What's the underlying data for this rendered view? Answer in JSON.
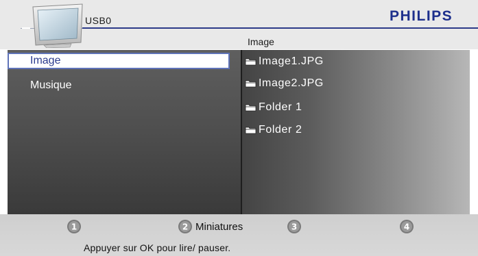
{
  "header": {
    "source_title": "USB0",
    "brand": "PHILIPS",
    "column_title": "Image"
  },
  "menu": {
    "items": [
      {
        "label": "Image",
        "selected": true
      },
      {
        "label": "Musique",
        "selected": false
      }
    ]
  },
  "files": {
    "items": [
      {
        "label": "Image1.JPG",
        "icon": "folder-icon"
      },
      {
        "label": "Image2.JPG",
        "icon": "folder-icon"
      },
      {
        "label": "Folder 1",
        "icon": "folder-icon"
      },
      {
        "label": "Folder 2",
        "icon": "folder-icon"
      }
    ]
  },
  "footer": {
    "keys": [
      {
        "number": "1",
        "label": ""
      },
      {
        "number": "2",
        "label": "Miniatures"
      },
      {
        "number": "3",
        "label": ""
      },
      {
        "number": "4",
        "label": ""
      }
    ],
    "hint": "Appuyer sur OK pour lire/ pauser."
  },
  "colors": {
    "brand": "#1d2f8c",
    "selection_text": "#2a3a8e",
    "selection_border": "#5f73b8"
  }
}
